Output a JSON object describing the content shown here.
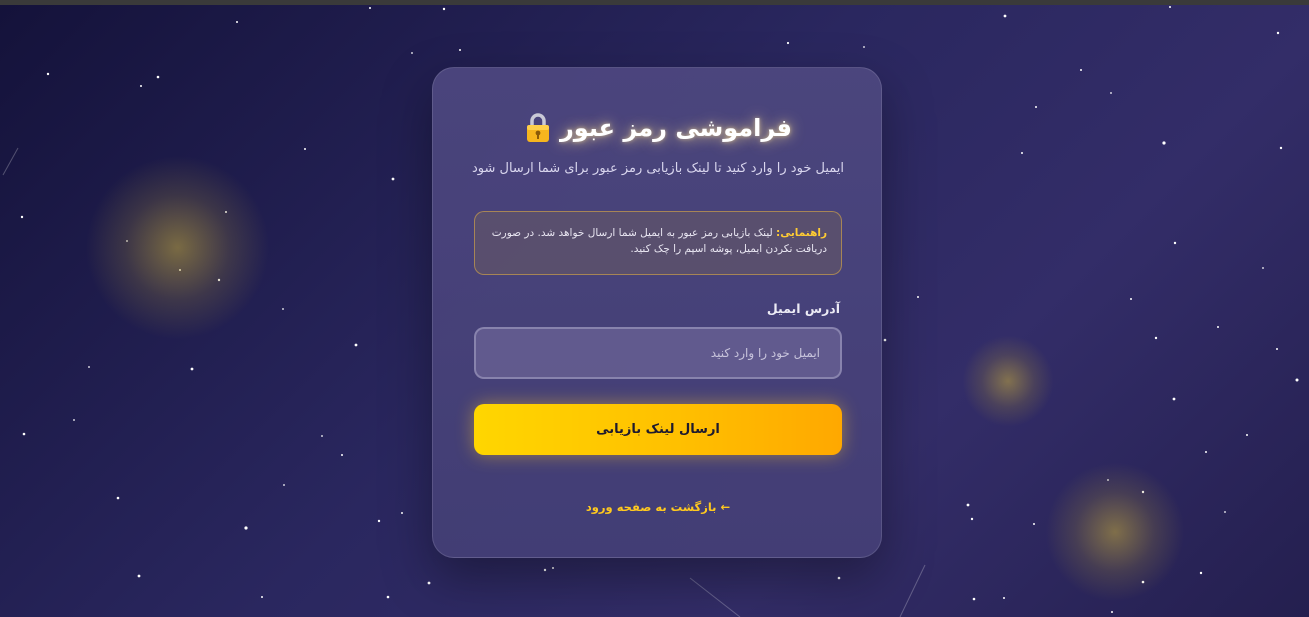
{
  "card": {
    "title": "فراموشی رمز عبور",
    "lock_icon": "lock-icon",
    "subtitle": "ایمیل خود را وارد کنید تا لینک بازیابی رمز عبور برای شما ارسال شود",
    "hint": {
      "label": "راهنمایی:",
      "text": " لینک بازیابی رمز عبور به ایمیل شما ارسال خواهد شد. در صورت دریافت نکردن ایمیل، پوشه اسپم را چک کنید."
    },
    "email_label": "آدرس ایمیل",
    "email_placeholder": "ایمیل خود را وارد کنید",
    "email_value": "",
    "submit_label": "ارسال لینک بازیابی",
    "back_link": "← بازگشت به صفحه ورود"
  },
  "colors": {
    "accent": "#ffc000",
    "link": "#ffc91f",
    "hint_label": "#ffcc33"
  }
}
